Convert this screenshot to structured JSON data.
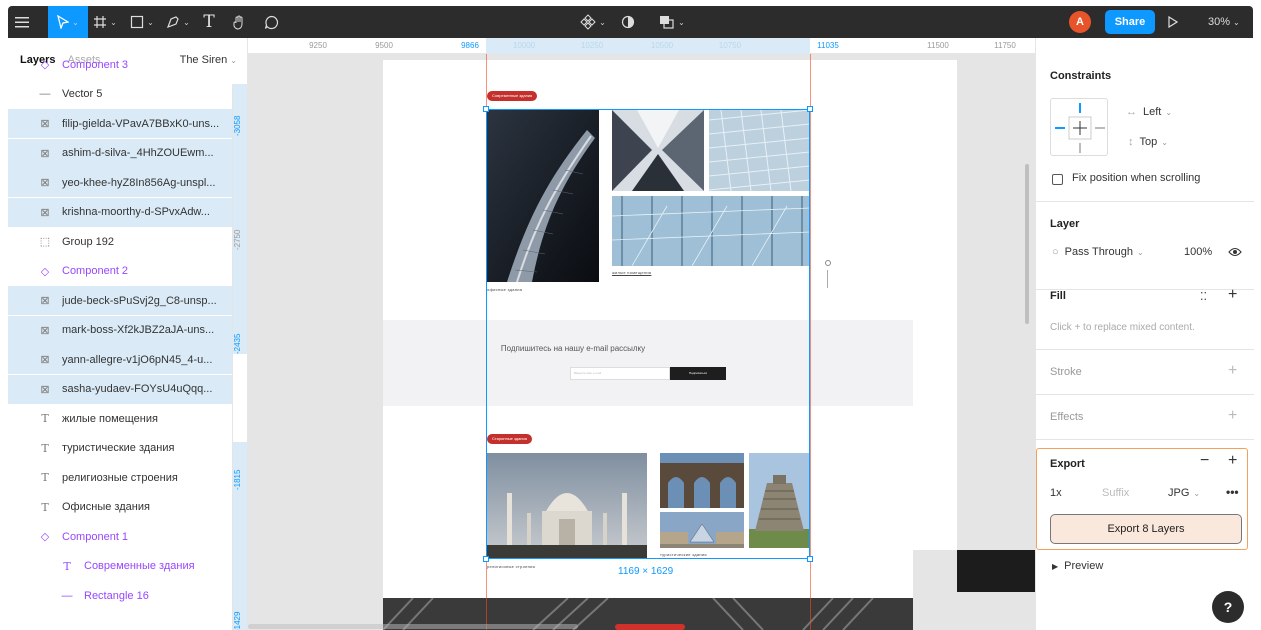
{
  "toolbar": {
    "menu_icon": "menu-icon",
    "move_tool": "move-tool-icon",
    "frame_tool": "frame-tool-icon",
    "shape_tool": "rectangle-tool-icon",
    "pen_tool": "pen-tool-icon",
    "text_tool_glyph": "T",
    "hand_tool": "hand-tool-icon",
    "comment_tool": "comment-tool-icon",
    "component_tool": "component-icon",
    "mask_tool": "mask-icon",
    "fill_tool": "boolean-icon",
    "avatar_initial": "A",
    "share_label": "Share",
    "zoom_label": "30%"
  },
  "left_panel": {
    "tab_layers": "Layers",
    "tab_assets": "Assets",
    "page_name": "The Siren",
    "layers": [
      {
        "name": "Component 3",
        "kind": "component",
        "selected": false
      },
      {
        "name": "Vector 5",
        "kind": "vector",
        "selected": false
      },
      {
        "name": "filip-gielda-VPavA7BBxK0-uns...",
        "kind": "image",
        "selected": true
      },
      {
        "name": "ashim-d-silva-_4HhZOUEwm...",
        "kind": "image",
        "selected": true
      },
      {
        "name": "yeo-khee-hyZ8In856Ag-unspl...",
        "kind": "image",
        "selected": true
      },
      {
        "name": "krishna-moorthy-d-SPvxAdw...",
        "kind": "image",
        "selected": true
      },
      {
        "name": "Group 192",
        "kind": "group",
        "selected": false
      },
      {
        "name": "Component 2",
        "kind": "component",
        "selected": false
      },
      {
        "name": "jude-beck-sPuSvj2g_C8-unsp...",
        "kind": "image",
        "selected": true
      },
      {
        "name": "mark-boss-Xf2kJBZ2aJA-uns...",
        "kind": "image",
        "selected": true
      },
      {
        "name": "yann-allegre-v1jO6pN45_4-u...",
        "kind": "image",
        "selected": true
      },
      {
        "name": "sasha-yudaev-FOYsU4uQqq...",
        "kind": "image",
        "selected": true
      },
      {
        "name": "жилые помещения",
        "kind": "text",
        "selected": false
      },
      {
        "name": "туристические здания",
        "kind": "text",
        "selected": false
      },
      {
        "name": "религиозные строения",
        "kind": "text",
        "selected": false
      },
      {
        "name": "Офисные здания",
        "kind": "text",
        "selected": false
      },
      {
        "name": "Component 1",
        "kind": "component",
        "selected": false
      },
      {
        "name": "Современные здания",
        "kind": "text-component",
        "selected": false
      },
      {
        "name": "Rectangle 16",
        "kind": "rect-component",
        "selected": false
      }
    ],
    "vertical_ruler": [
      "-3058",
      "-2750",
      "-2435",
      "-1815",
      "-1429"
    ]
  },
  "ruler": {
    "ticks": [
      "9250",
      "9500",
      "9866",
      "10000",
      "10250",
      "10500",
      "10750",
      "11035",
      "11500",
      "11750"
    ]
  },
  "canvas": {
    "tag_modern": "Современные здания",
    "caption_office": "офисные здания",
    "caption_residential": "жилые помещения",
    "subscribe_title": "Подпишитесь на нашу e-mail рассылку",
    "subscribe_placeholder": "Введите ваш e-mail",
    "subscribe_button": "Подписаться",
    "tag_ancient": "Старинные здания",
    "caption_religious": "религиозные строения",
    "caption_tourist": "туристические здания",
    "selection_size": "1169 × 1629"
  },
  "right_panel": {
    "constraints_title": "Constraints",
    "constraint_h": "Left",
    "constraint_v": "Top",
    "fix_position_label": "Fix position when scrolling",
    "layer_title": "Layer",
    "blend_mode": "Pass Through",
    "opacity": "100%",
    "fill_title": "Fill",
    "fill_hint": "Click + to replace mixed content.",
    "stroke_title": "Stroke",
    "effects_title": "Effects",
    "export_title": "Export",
    "export_scale": "1x",
    "export_suffix_placeholder": "Suffix",
    "export_format": "JPG",
    "export_button": "Export 8 Layers",
    "preview_label": "Preview",
    "help_label": "?"
  },
  "colors": {
    "toolbar_bg": "#2c2c2c",
    "accent_blue": "#0d99ff",
    "selection_bg": "#daebf7",
    "component_purple": "#9747ff",
    "export_highlight": "#f5a05a",
    "tag_red": "#c4302b"
  }
}
